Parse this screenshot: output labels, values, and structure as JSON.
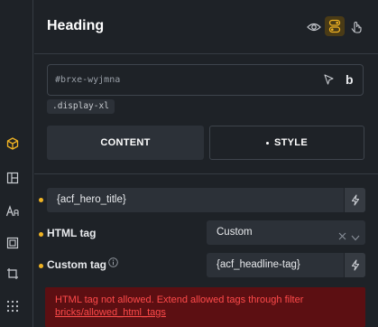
{
  "header": {
    "title": "Heading",
    "icons": [
      "eye-icon",
      "toggle-icon",
      "pointer-cursor-icon"
    ],
    "accent_color": "#f0b323"
  },
  "element": {
    "id": "#brxe-wyjmna",
    "class_chip": ".display-xl"
  },
  "tabs": {
    "content_label": "CONTENT",
    "style_label": "STYLE"
  },
  "fields": {
    "text_value": "{acf_hero_title}",
    "html_tag_label": "HTML tag",
    "html_tag_value": "Custom",
    "custom_tag_label": "Custom tag",
    "custom_tag_value": "{acf_headline-tag}"
  },
  "error": {
    "message": "HTML tag not allowed. Extend allowed tags through filter",
    "link": "bricks/allowed_html_tags",
    "color": "#ff4a4a"
  },
  "left_rail_icons": [
    "cube-icon",
    "layout-icon",
    "typography-icon",
    "frame-icon",
    "crop-icon",
    "grid-dots-icon"
  ]
}
